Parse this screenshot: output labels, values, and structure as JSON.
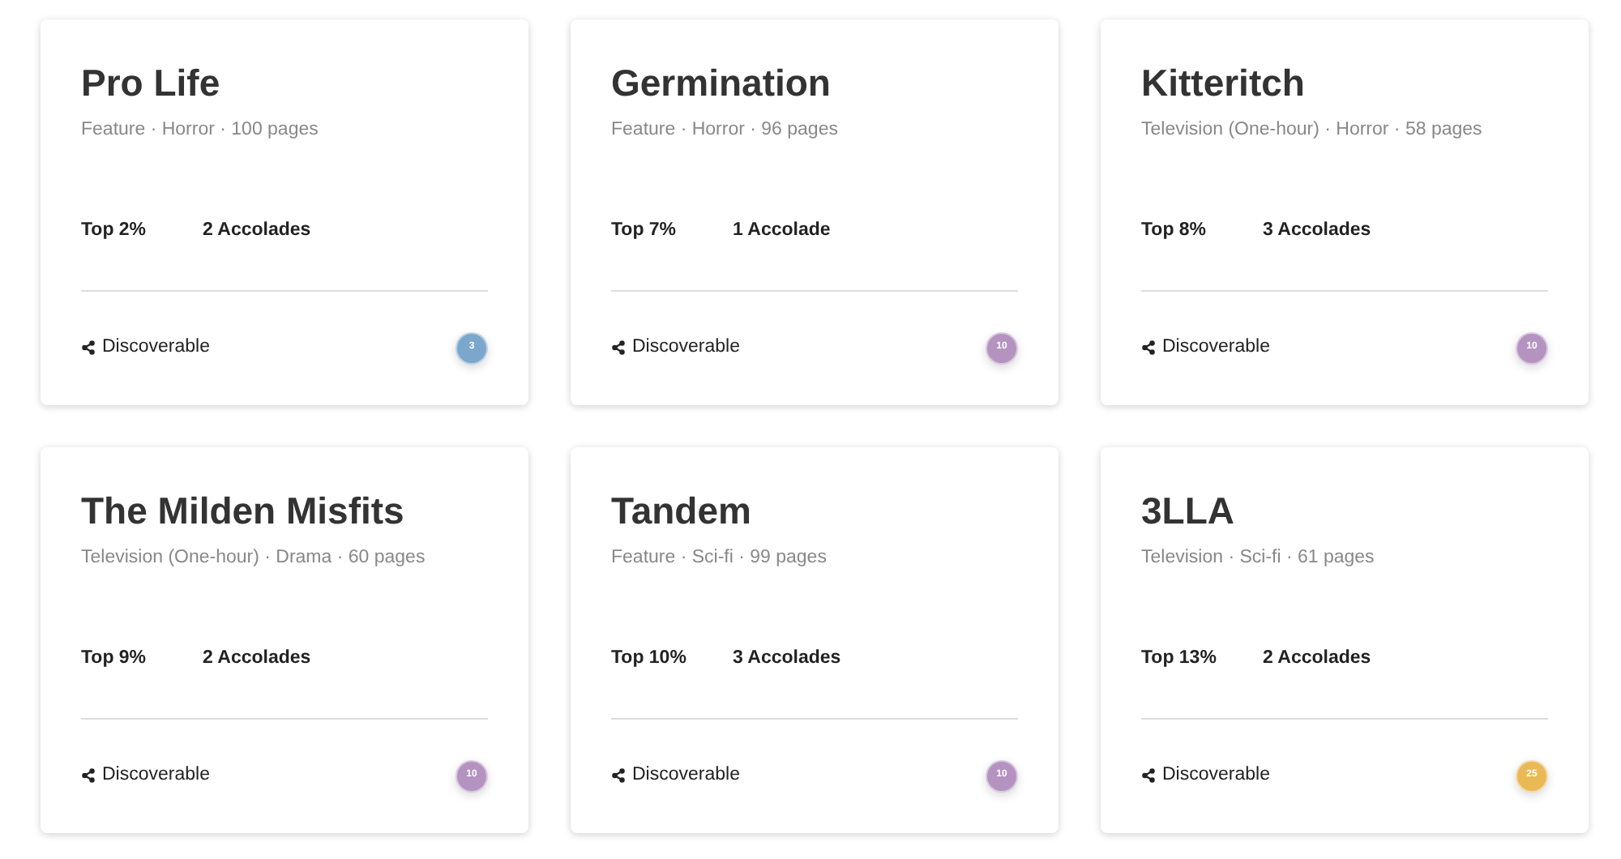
{
  "projects": [
    {
      "title": "Pro Life",
      "meta": "Feature · Horror · 100 pages",
      "rank": "Top 2%",
      "accolades": "2 Accolades",
      "status": "Discoverable",
      "badge": "3",
      "color": "#7ba7cc"
    },
    {
      "title": "Germination",
      "meta": "Feature · Horror · 96 pages",
      "rank": "Top 7%",
      "accolades": "1 Accolade",
      "status": "Discoverable",
      "badge": "10",
      "color": "#b493c0"
    },
    {
      "title": "Kitteritch",
      "meta": "Television (One-hour) · Horror · 58 pages",
      "rank": "Top 8%",
      "accolades": "3 Accolades",
      "status": "Discoverable",
      "badge": "10",
      "color": "#b493c0"
    },
    {
      "title": "The Milden Misfits",
      "meta": "Television (One-hour) · Drama · 60 pages",
      "rank": "Top 9%",
      "accolades": "2 Accolades",
      "status": "Discoverable",
      "badge": "10",
      "color": "#b493c0"
    },
    {
      "title": "Tandem",
      "meta": "Feature · Sci-fi · 99 pages",
      "rank": "Top 10%",
      "accolades": "3 Accolades",
      "status": "Discoverable",
      "badge": "10",
      "color": "#b493c0"
    },
    {
      "title": "3LLA",
      "meta": "Television · Sci-fi · 61 pages",
      "rank": "Top 13%",
      "accolades": "2 Accolades",
      "status": "Discoverable",
      "badge": "25",
      "color": "#e9b955"
    }
  ]
}
